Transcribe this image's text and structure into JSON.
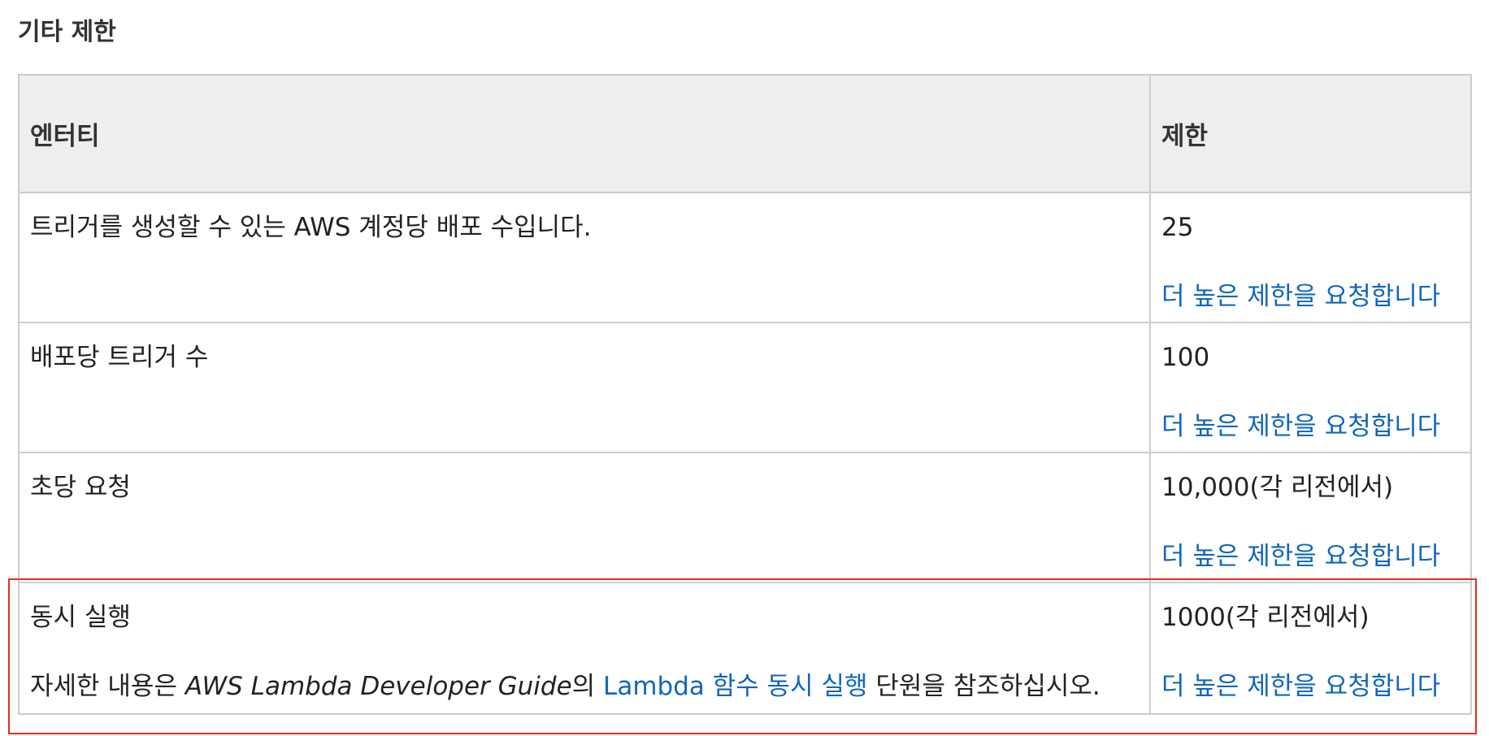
{
  "section": {
    "title": "기타 제한"
  },
  "table": {
    "headers": {
      "entity": "엔터티",
      "limit": "제한"
    },
    "rows": [
      {
        "entity": "트리거를 생성할 수 있는 AWS 계정당 배포 수입니다.",
        "limit": "25",
        "request_link": "더 높은 제한을 요청합니다"
      },
      {
        "entity": "배포당 트리거 수",
        "limit": "100",
        "request_link": "더 높은 제한을 요청합니다"
      },
      {
        "entity": "초당 요청",
        "limit": "10,000(각 리전에서)",
        "request_link": "더 높은 제한을 요청합니다"
      },
      {
        "entity": "동시 실행",
        "note": {
          "prefix": "자세한 내용은 ",
          "guide": "AWS Lambda Developer Guide",
          "particle": "의 ",
          "link": "Lambda 함수 동시 실행",
          "suffix": " 단원을 참조하십시오."
        },
        "limit": "1000(각 리전에서)",
        "request_link": "더 높은 제한을 요청합니다"
      }
    ]
  },
  "colors": {
    "link": "#1166bb",
    "header_bg": "#eeeeee",
    "border": "#cccccc",
    "highlight": "#e0301e"
  }
}
